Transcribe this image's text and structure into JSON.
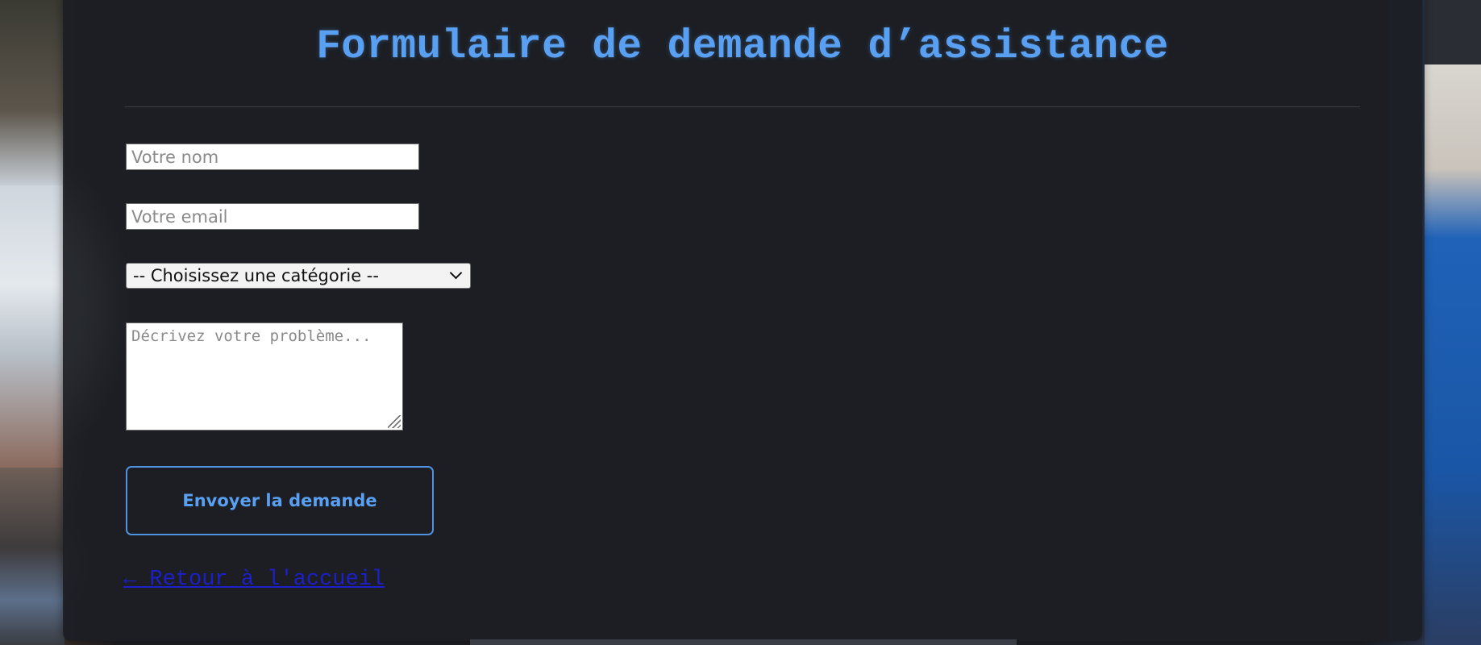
{
  "form": {
    "title": "Formulaire de demande d’assistance",
    "name_placeholder": "Votre nom",
    "email_placeholder": "Votre email",
    "category_selected": "-- Choisissez une catégorie --",
    "description_placeholder": "Décrivez votre problème...",
    "submit_label": "Envoyer la demande",
    "back_link_label": "← Retour à l'accueil"
  },
  "colors": {
    "accent": "#5aa0f2",
    "card_background": "#1c1e24",
    "link": "#1d1fc9"
  }
}
